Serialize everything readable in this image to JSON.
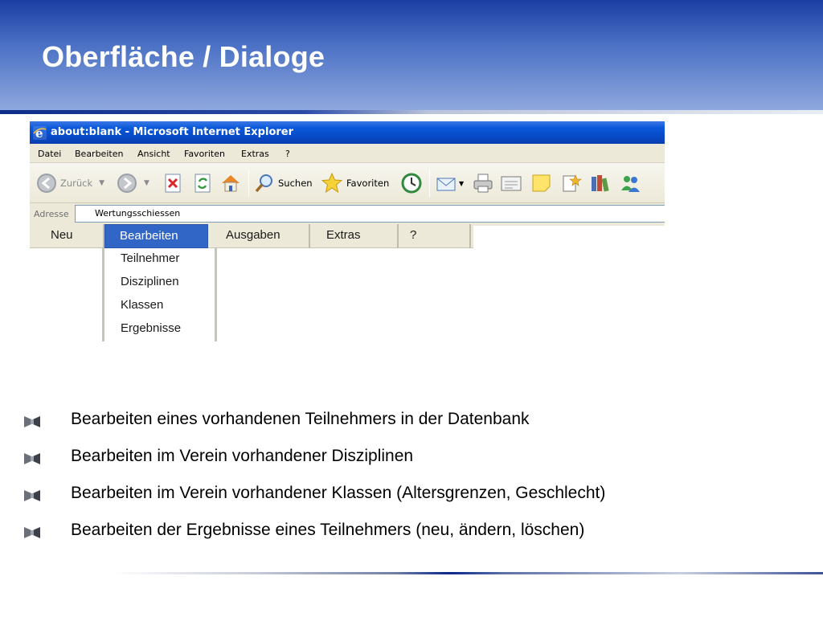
{
  "slide": {
    "title": "Oberfläche / Dialoge"
  },
  "ie": {
    "window_title": "about:blank - Microsoft Internet Explorer",
    "menu": [
      "Datei",
      "Bearbeiten",
      "Ansicht",
      "Favoriten",
      "Extras",
      "?"
    ],
    "toolbar": {
      "back_label": "Zurück",
      "search_label": "Suchen",
      "favorites_label": "Favoriten"
    },
    "address": {
      "label": "Adresse",
      "value": "Wertungsschiessen"
    }
  },
  "app_menu": {
    "items": [
      "Neu",
      "Bearbeiten",
      "Ausgaben",
      "Extras",
      "?"
    ],
    "active": "Bearbeiten",
    "dropdown": [
      "Teilnehmer",
      "Disziplinen",
      "Klassen",
      "Ergebnisse"
    ]
  },
  "bullets": [
    "Bearbeiten eines vorhandenen Teilnehmers in der Datenbank",
    "Bearbeiten im Verein vorhandener Disziplinen",
    "Bearbeiten im Verein vorhandener Klassen (Altersgrenzen, Geschlecht)",
    "Bearbeiten der Ergebnisse eines Teilnehmers (neu, ändern, löschen)"
  ],
  "colors": {
    "header_top": "#1a3ea3",
    "header_bottom": "#8fa8de",
    "xp_titlebar": "#0a58d9",
    "menu_highlight": "#3166c7"
  }
}
